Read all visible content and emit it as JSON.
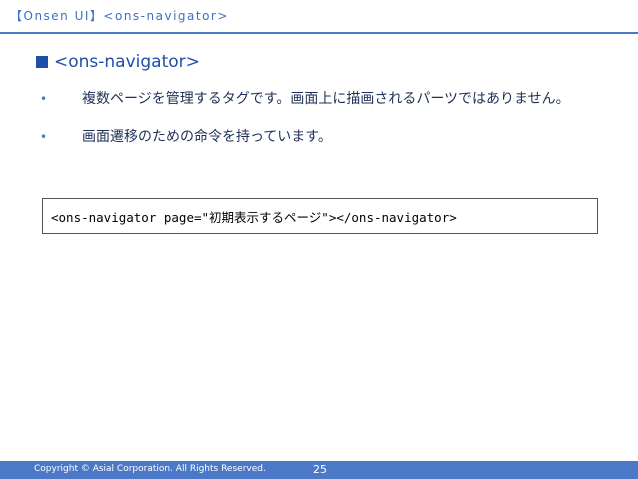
{
  "header": {
    "title": "【Onsen UI】<ons-navigator>"
  },
  "heading": {
    "text": "<ons-navigator>"
  },
  "bullets": [
    {
      "text": "複数ページを管理するタグです。画面上に描画されるパーツではありません。"
    },
    {
      "text": "画面遷移のための命令を持っています。"
    }
  ],
  "code": {
    "text": "<ons-navigator page=\"初期表示するページ\"></ons-navigator>"
  },
  "footer": {
    "copyright": "Copyright © Asial Corporation. All Rights Reserved.",
    "page_number": "25"
  },
  "colors": {
    "accent": "#4b79c8",
    "heading": "#1f4fa8"
  }
}
